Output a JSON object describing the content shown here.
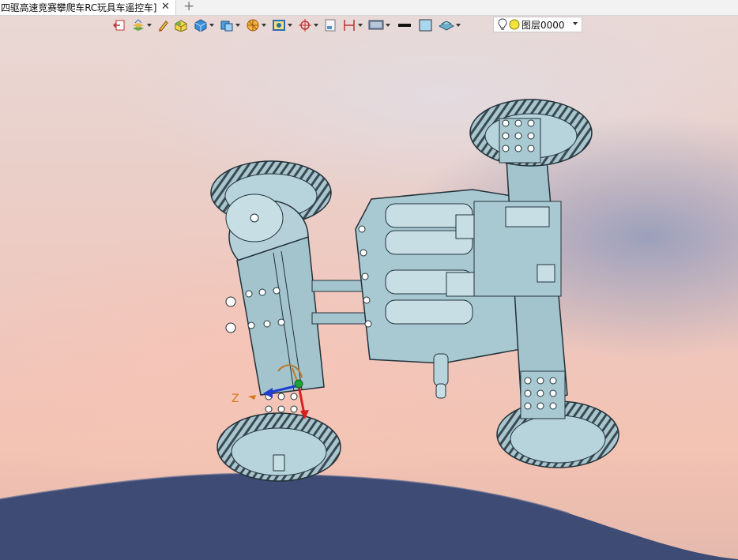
{
  "tab": {
    "title": "四驱高速竞赛攀爬车RC玩具车遥控车]",
    "close_glyph": "✕",
    "add_glyph": "+"
  },
  "toolbar": {
    "icons": [
      "exit-icon",
      "layers-icon",
      "pencil-icon",
      "box-icon",
      "cube-icon",
      "view-cube-icon",
      "render-icon",
      "frame-icon",
      "target-icon",
      "note-icon",
      "dimension-icon",
      "display-icon",
      "color-swatch-icon",
      "fill-swatch-icon",
      "shape-icon"
    ],
    "layer": {
      "value": "图层0000"
    }
  },
  "viewport": {
    "triad_label": "Z"
  },
  "colors": {
    "model": "#a9c9d2",
    "model_edge": "#2a3a40",
    "sky_top": "#e9d9d6",
    "sky_bottom": "#f3c3b3",
    "hill": "#3c4a74"
  }
}
